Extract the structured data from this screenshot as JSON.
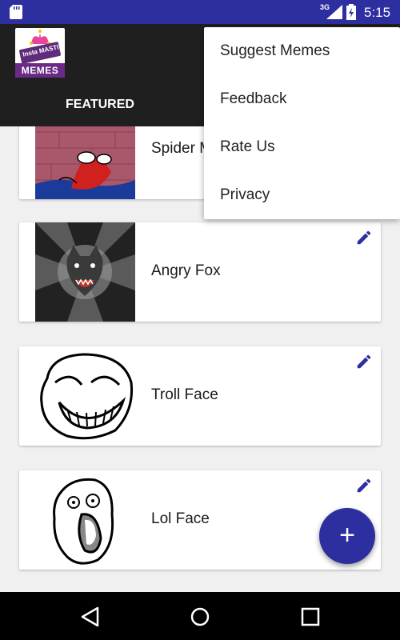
{
  "status_bar": {
    "network": "3G",
    "time": "5:15",
    "icons": [
      "sd-card-icon",
      "signal-icon",
      "battery-icon"
    ]
  },
  "app_bar": {
    "logo": {
      "badge_text": "Insta MASTI",
      "label": "MEMES",
      "icon": "jester-hat-icon"
    },
    "tabs": [
      {
        "label": "FEATURED",
        "selected": true
      }
    ]
  },
  "overflow_menu": {
    "items": [
      {
        "label": "Suggest Memes"
      },
      {
        "label": "Feedback"
      },
      {
        "label": "Rate Us"
      },
      {
        "label": "Privacy"
      }
    ]
  },
  "memes": [
    {
      "title": "Spider Man",
      "thumb": "spider-man-meme",
      "edit_icon": "pencil-icon"
    },
    {
      "title": "Angry Fox",
      "thumb": "angry-wolf-meme",
      "edit_icon": "pencil-icon"
    },
    {
      "title": "Troll Face",
      "thumb": "troll-face-meme",
      "edit_icon": "pencil-icon"
    },
    {
      "title": "Lol Face",
      "thumb": "lol-face-meme",
      "edit_icon": "pencil-icon"
    }
  ],
  "fab": {
    "label": "+",
    "icon": "add-icon"
  },
  "nav_bar": {
    "buttons": [
      "back-icon",
      "home-icon",
      "recents-icon"
    ]
  },
  "colors": {
    "primary": "#2d2fa0",
    "app_bar": "#1f1f1f",
    "accent_icon": "#2d2fa0",
    "background": "#f0f0f0"
  }
}
